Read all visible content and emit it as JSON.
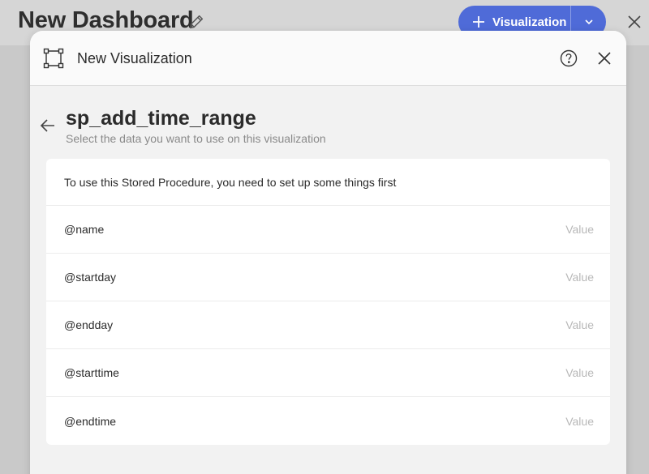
{
  "dashboard": {
    "title": "New Dashboard",
    "visualization_button_label": "Visualization"
  },
  "modal": {
    "title": "New Visualization",
    "procedure_name": "sp_add_time_range",
    "subtitle": "Select the data you want to use on this visualization",
    "setup_message": "To use this Stored Procedure, you need to set up some things first",
    "parameters": [
      {
        "name": "@name",
        "placeholder": "Value"
      },
      {
        "name": "@startday",
        "placeholder": "Value"
      },
      {
        "name": "@endday",
        "placeholder": "Value"
      },
      {
        "name": "@starttime",
        "placeholder": "Value"
      },
      {
        "name": "@endtime",
        "placeholder": "Value"
      }
    ]
  },
  "colors": {
    "accent": "#4f6bd8",
    "backdrop": "#c9c9c9",
    "modal_bg": "#f2f2f2"
  },
  "icons": [
    "pencil-icon",
    "plus-icon",
    "chevron-down-icon",
    "close-icon",
    "visualization-icon",
    "help-icon",
    "back-arrow-icon"
  ]
}
